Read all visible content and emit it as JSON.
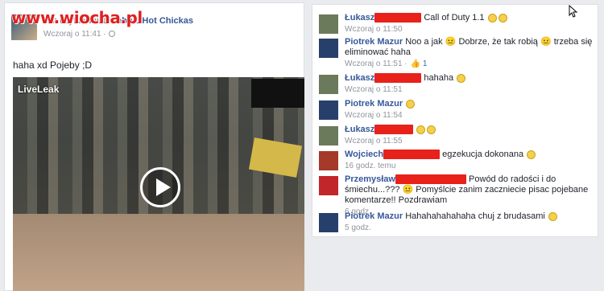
{
  "watermark": "www.wiocha.pl",
  "post": {
    "header_text": "film użytkownika",
    "header_link": "Cebu's Hot Chickas",
    "time": "Wczoraj o 11:41 ·",
    "text": "haha xd Pojeby ;D",
    "video_brand": "LiveLeak"
  },
  "comments": [
    {
      "author": "Łukasz",
      "text": "Call of Duty 1.1",
      "time": "Wczoraj o 11:50",
      "avatar_color": "#6b7a5a",
      "redact_w": 58,
      "emojis": 2
    },
    {
      "author": "Piotrek Mazur",
      "text": "Noo a jak 😐 Dobrze, że tak robią 😐 trzeba się eliminować haha",
      "time": "Wczoraj o 11:51 ·",
      "likes": "1",
      "avatar_color": "#27406b",
      "redact_w": 0,
      "emojis": 0
    },
    {
      "author": "Łukasz",
      "text": "hahaha",
      "time": "Wczoraj o 11:51",
      "avatar_color": "#6b7a5a",
      "redact_w": 58,
      "emojis": 1
    },
    {
      "author": "Piotrek Mazur",
      "text": "",
      "time": "Wczoraj o 11:54",
      "avatar_color": "#27406b",
      "redact_w": 0,
      "emojis": 1
    },
    {
      "author": "Łukasz",
      "text": "",
      "time": "Wczoraj o 11:55",
      "avatar_color": "#6b7a5a",
      "redact_w": 48,
      "emojis": 2
    },
    {
      "author": "Wojciech",
      "text": "egzekucja dokonana",
      "time": "16 godz. temu",
      "avatar_color": "#a53a2a",
      "redact_w": 70,
      "emojis": 1
    },
    {
      "author": "Przemysław",
      "text": "Powód do radości i do śmiechu...??? 😐 Pomyślcie zanim zaczniecie pisac pojebane komentarze!! Pozdrawiam",
      "time": "6 godz.",
      "avatar_color": "#c0262a",
      "redact_w": 88,
      "emojis": 0
    },
    {
      "author": "Piotrek Mazur",
      "text": "Hahahahahahaha chuj z brudasami",
      "time": "5 godz.",
      "avatar_color": "#27406b",
      "redact_w": 0,
      "emojis": 1
    }
  ]
}
